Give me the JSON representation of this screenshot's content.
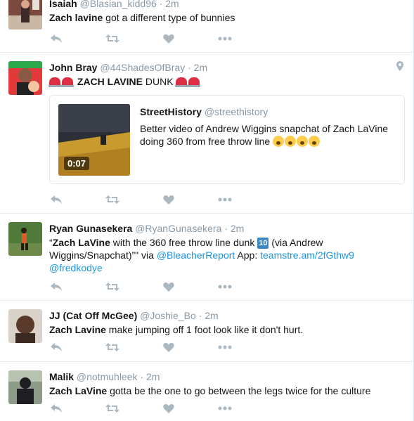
{
  "tweets": [
    {
      "name": "Isaiah",
      "handle": "@Blasian_kidd96",
      "time": "2m",
      "text_bold": "Zach lavine",
      "text_rest": " got a different type of bunnies"
    },
    {
      "name": "John Bray",
      "handle": "@44ShadesOfBray",
      "time": "2m",
      "text_bold": "ZACH LAVINE",
      "text_rest": " DUNK",
      "card": {
        "name": "StreetHistory",
        "handle": "@streethistory",
        "text": "Better video of Andrew Wiggins snapchat of Zach LaVine doing 360 from free throw line",
        "duration": "0:07"
      }
    },
    {
      "name": "Ryan Gunasekera",
      "handle": "@RyanGunasekera",
      "time": "2m",
      "text_open": "“",
      "text_bold": "Zach LaVine",
      "text_mid": " with the 360 free throw line dunk ",
      "keycap": "10",
      "text_after": " (via Andrew Wiggins/Snapchat)”\" via ",
      "mention1": "@BleacherReport",
      "text_app": " App: ",
      "url": "teamstre.am/2fGthw9",
      "mention2": "@fredkodye"
    },
    {
      "name": "JJ (Cat Off McGee)",
      "handle": "@Joshie_Bo",
      "time": "2m",
      "text_bold": "Zach Lavine",
      "text_rest": " make jumping off 1 foot look like it don't hurt."
    },
    {
      "name": "Malik",
      "handle": "@notmuhleek",
      "time": "2m",
      "text_bold": "Zach LaVine",
      "text_rest": " gotta be the one to go between the legs twice for the culture"
    }
  ],
  "dot": "·",
  "icons": {
    "reply": "reply-icon",
    "retweet": "retweet-icon",
    "like": "heart-icon",
    "more": "more-icon",
    "location": "location-pin-icon"
  },
  "colors": {
    "icon": "#aab8c2",
    "link": "#1b95e0",
    "muted": "#8899a6"
  }
}
